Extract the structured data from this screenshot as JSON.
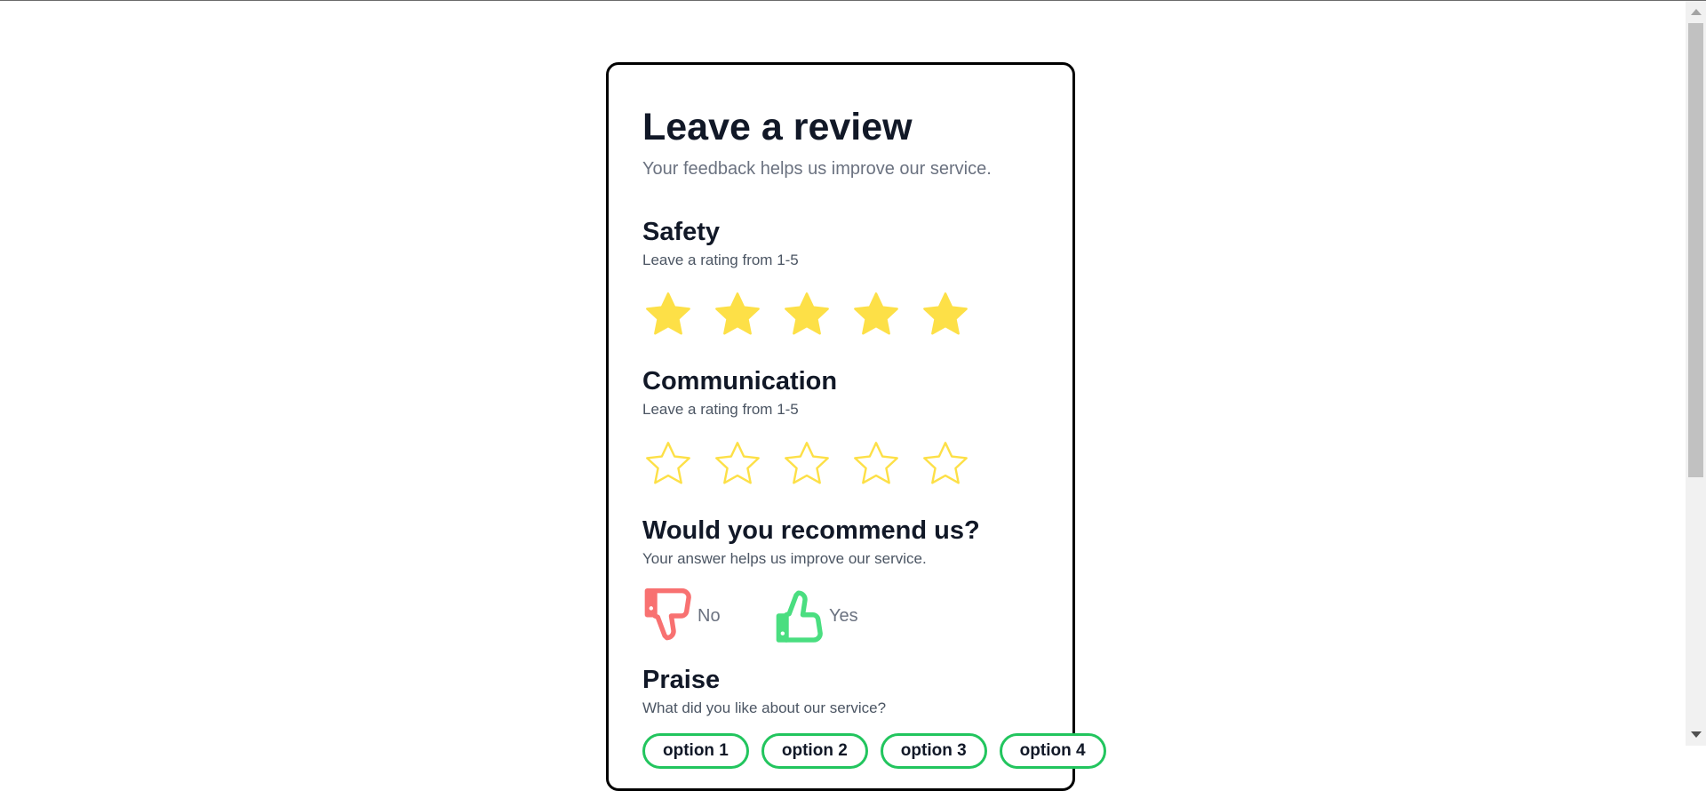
{
  "form": {
    "title": "Leave a review",
    "subtitle": "Your feedback helps us improve our service.",
    "safety": {
      "title": "Safety",
      "hint": "Leave a rating from 1-5",
      "rating": 5,
      "max": 5
    },
    "communication": {
      "title": "Communication",
      "hint": "Leave a rating from 1-5",
      "rating": 0,
      "max": 5
    },
    "recommend": {
      "title": "Would you recommend us?",
      "hint": "Your answer helps us improve our service.",
      "no_label": "No",
      "yes_label": "Yes"
    },
    "praise": {
      "title": "Praise",
      "hint": "What did you like about our service?",
      "options": [
        "option 1",
        "option 2",
        "option 3",
        "option 4"
      ]
    }
  },
  "icons": {
    "star": "star-icon",
    "thumbs_down": "thumbs-down-icon",
    "thumbs_up": "thumbs-up-icon"
  },
  "colors": {
    "star_fill": "#fde047",
    "star_outline": "#fde047",
    "thumbs_down": "#f87171",
    "thumbs_up": "#4ade80",
    "pill_border": "#22c55e",
    "card_border": "#000000",
    "muted_text": "#6b7280"
  }
}
